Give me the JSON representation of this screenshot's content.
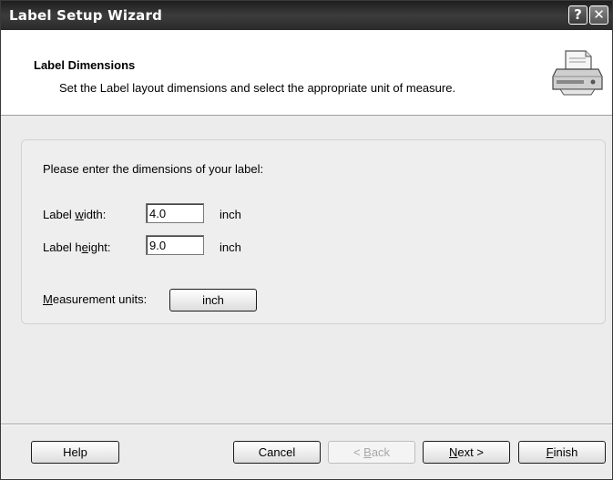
{
  "window": {
    "title": "Label Setup Wizard",
    "help_glyph": "?",
    "close_glyph": "✕"
  },
  "header": {
    "title": "Label Dimensions",
    "subtitle": "Set the Label layout dimensions and select the appropriate unit of measure.",
    "icon": "printer-icon"
  },
  "form": {
    "prompt": "Please enter the dimensions of your label:",
    "width": {
      "label_pre": "Label ",
      "label_key": "w",
      "label_post": "idth:",
      "value": "4.0",
      "unit": "inch"
    },
    "height": {
      "label_pre": "Label h",
      "label_key": "e",
      "label_post": "ight:",
      "value": "9.0",
      "unit": "inch"
    },
    "units": {
      "label_key": "M",
      "label_post": "easurement units:",
      "button": "inch"
    }
  },
  "footer": {
    "help": "Help",
    "cancel": "Cancel",
    "back_pre": "< ",
    "back_key": "B",
    "back_post": "ack",
    "next_key": "N",
    "next_post": "ext >",
    "finish_key": "F",
    "finish_post": "inish"
  }
}
